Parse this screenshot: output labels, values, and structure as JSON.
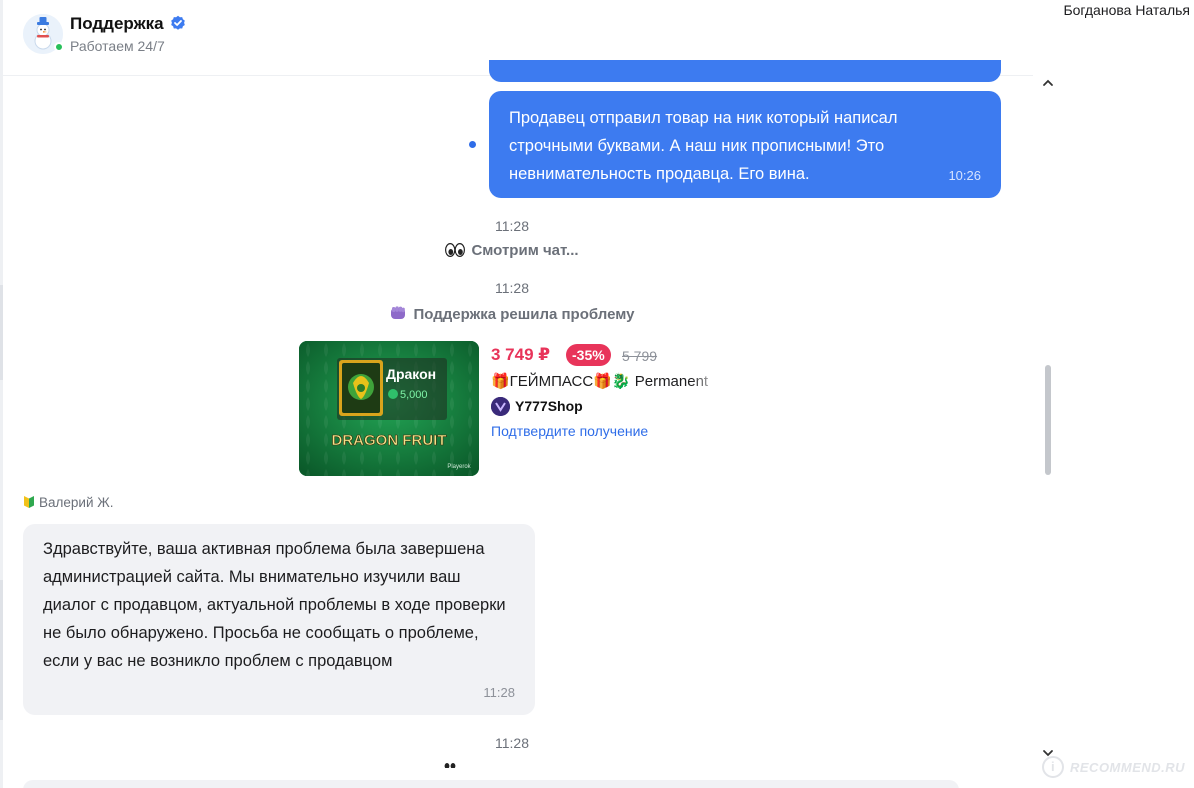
{
  "header": {
    "title": "Поддержка",
    "status": "Работаем 24/7",
    "online": true
  },
  "user": {
    "name": "Богданова Наталья"
  },
  "messages": {
    "outgoing": {
      "text": "Продавец отправил товар на ник который написал строчными буквами. А наш ник прописными! Это невнимательность продавца. Его вина.",
      "time": "10:26"
    },
    "system_1": {
      "time": "11:28",
      "text": "Смотрим чат...",
      "icon": "eyes-icon"
    },
    "system_2": {
      "time": "11:28",
      "text": "Поддержка решила проблему",
      "icon": "fist-icon"
    },
    "product": {
      "price": "3 749 ₽",
      "discount": "-35%",
      "old_price": "5 799",
      "title": "🎁ГЕЙМПАСС🎁🐉 Permanent",
      "shop": "Y777Shop",
      "confirm_link": "Подтвердите получение",
      "image": {
        "item_name": "Дракон",
        "cost": "5,000",
        "banner": "DRAGON FRUIT",
        "watermark": "Playerok"
      }
    },
    "incoming": {
      "sender": "Валерий Ж.",
      "text": "Здравствуйте, ваша активная проблема была завершена администрацией сайта. Мы внимательно изучили ваш диалог с продавцом, актуальной проблемы в ходе проверки не было обнаружено. Просьба не сообщать о проблеме, если у вас не возникло проблем с продавцом",
      "time": "11:28"
    },
    "system_3": {
      "time": "11:28"
    }
  },
  "colors": {
    "outgoing_bubble": "#3d7bf0",
    "incoming_bubble": "#f1f2f5",
    "price": "#e8345a",
    "link": "#2f6de8",
    "online": "#27c05a"
  },
  "watermark": {
    "text": "RECOMMEND.RU",
    "glyph": "i"
  }
}
